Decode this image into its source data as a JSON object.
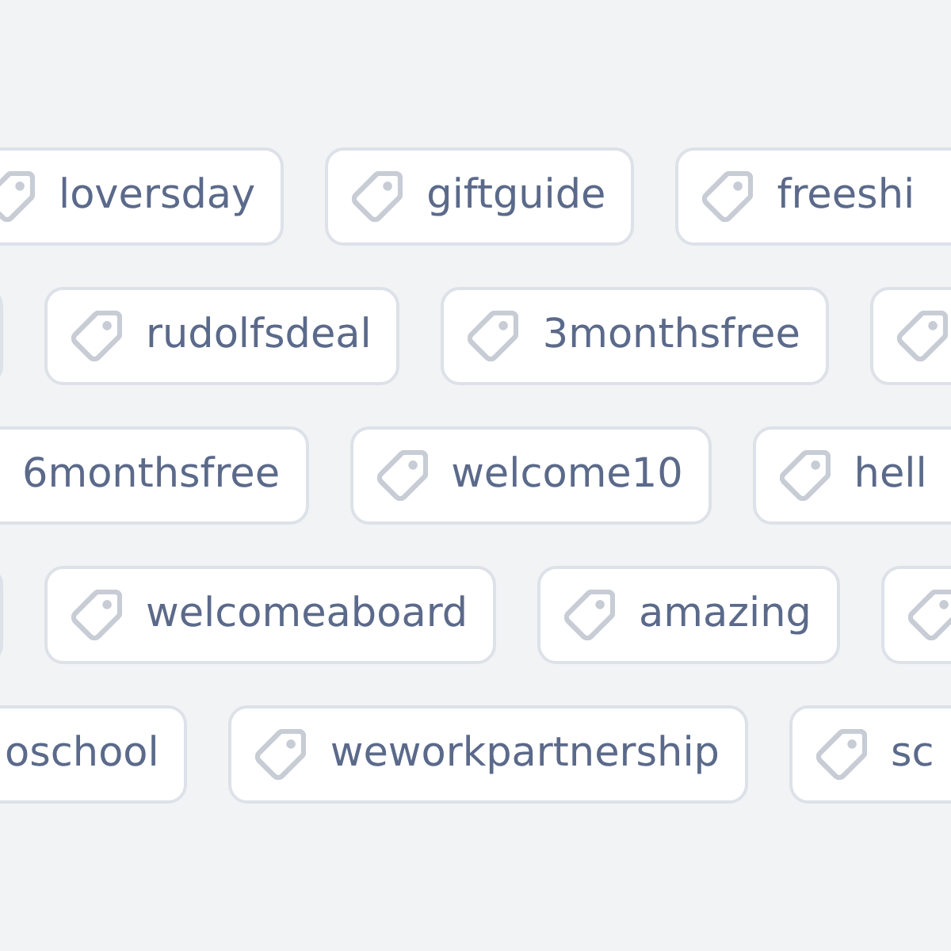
{
  "rows": [
    {
      "chips": [
        {
          "kind": "tag",
          "label": "loversday"
        },
        {
          "kind": "tag",
          "label": "giftguide"
        },
        {
          "kind": "tag",
          "label": "freeshi"
        }
      ]
    },
    {
      "chips": [
        {
          "kind": "edge"
        },
        {
          "kind": "tag",
          "label": "rudolfsdeal"
        },
        {
          "kind": "tag",
          "label": "3monthsfree"
        },
        {
          "kind": "icon"
        }
      ]
    },
    {
      "chips": [
        {
          "kind": "label",
          "label": "6monthsfree"
        },
        {
          "kind": "tag",
          "label": "welcome10"
        },
        {
          "kind": "tag",
          "label": "hell"
        }
      ]
    },
    {
      "chips": [
        {
          "kind": "edge"
        },
        {
          "kind": "tag",
          "label": "welcomeaboard"
        },
        {
          "kind": "tag",
          "label": "amazing"
        },
        {
          "kind": "icon"
        }
      ]
    },
    {
      "chips": [
        {
          "kind": "label",
          "label": "oschool"
        },
        {
          "kind": "tag",
          "label": "weworkpartnership"
        },
        {
          "kind": "tag",
          "label": "sc"
        }
      ]
    }
  ]
}
